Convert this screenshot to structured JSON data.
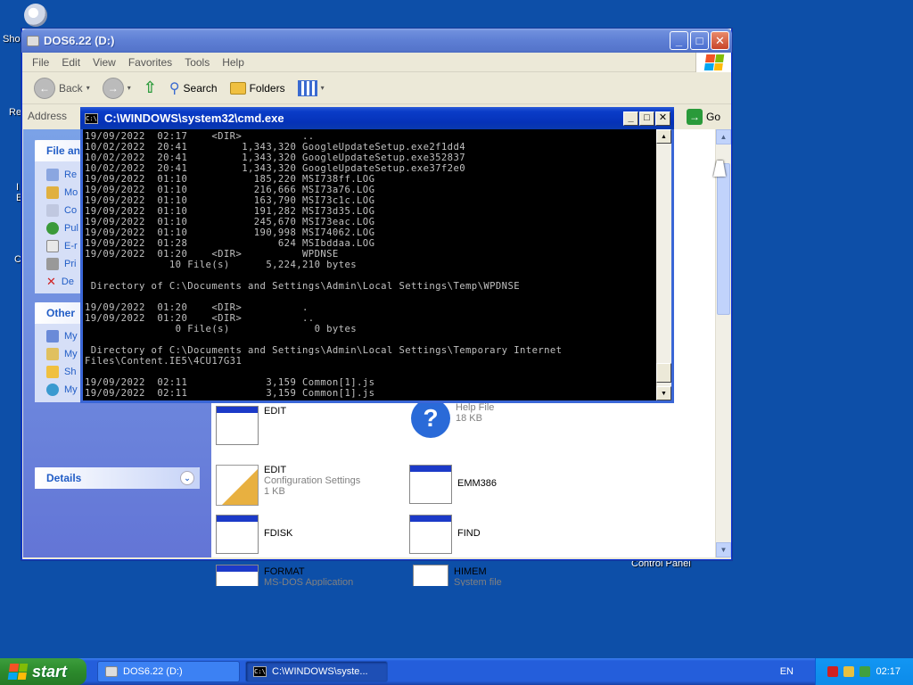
{
  "desktop": {
    "label_sho": "Sho",
    "label_re": "Re",
    "label_i": "I",
    "label_e": "E",
    "label_c": "C",
    "label_control_panel": "Control Panel"
  },
  "explorer": {
    "title": "DOS6.22 (D:)",
    "menu": [
      "File",
      "Edit",
      "View",
      "Favorites",
      "Tools",
      "Help"
    ],
    "toolbar": {
      "back": "Back",
      "search": "Search",
      "folders": "Folders"
    },
    "address_label": "Address",
    "go_label": "Go",
    "left": {
      "file_tasks_title": "File an",
      "file_tasks": [
        "Re",
        "Mo",
        "Co",
        "Pul",
        "E-r",
        "Pri",
        "De"
      ],
      "other_title": "Other",
      "other_items": [
        "My",
        "My",
        "Sh",
        "My Network Places"
      ],
      "details_title": "Details"
    },
    "files": [
      {
        "name": "EDIT",
        "sub1": "",
        "sub2": ""
      },
      {
        "name": "",
        "sub1": "Help File",
        "sub2": "18 KB"
      },
      {
        "name": "EDIT",
        "sub1": "Configuration Settings",
        "sub2": "1 KB"
      },
      {
        "name": "EMM386",
        "sub1": "",
        "sub2": ""
      },
      {
        "name": "FDISK",
        "sub1": "",
        "sub2": ""
      },
      {
        "name": "FIND",
        "sub1": "",
        "sub2": ""
      },
      {
        "name": "FORMAT",
        "sub1": "MS-DOS Application",
        "sub2": ""
      },
      {
        "name": "HIMEM",
        "sub1": "System file",
        "sub2": ""
      }
    ]
  },
  "cmd": {
    "title": "C:\\WINDOWS\\system32\\cmd.exe",
    "output": "19/09/2022  02:17    <DIR>          ..\n10/02/2022  20:41         1,343,320 GoogleUpdateSetup.exe2f1dd4\n10/02/2022  20:41         1,343,320 GoogleUpdateSetup.exe352837\n10/02/2022  20:41         1,343,320 GoogleUpdateSetup.exe37f2e0\n19/09/2022  01:10           185,220 MSI738ff.LOG\n19/09/2022  01:10           216,666 MSI73a76.LOG\n19/09/2022  01:10           163,790 MSI73c1c.LOG\n19/09/2022  01:10           191,282 MSI73d35.LOG\n19/09/2022  01:10           245,670 MSI73eac.LOG\n19/09/2022  01:10           190,998 MSI74062.LOG\n19/09/2022  01:28               624 MSIbddaa.LOG\n19/09/2022  01:20    <DIR>          WPDNSE\n              10 File(s)      5,224,210 bytes\n\n Directory of C:\\Documents and Settings\\Admin\\Local Settings\\Temp\\WPDNSE\n\n19/09/2022  01:20    <DIR>          .\n19/09/2022  01:20    <DIR>          ..\n               0 File(s)              0 bytes\n\n Directory of C:\\Documents and Settings\\Admin\\Local Settings\\Temporary Internet\nFiles\\Content.IE5\\4CU17G31\n\n19/09/2022  02:11             3,159 Common[1].js\n19/09/2022  02:11             3,159 Common[1].js"
  },
  "taskbar": {
    "start": "start",
    "tasks": [
      "DOS6.22 (D:)",
      "C:\\WINDOWS\\syste..."
    ],
    "lang": "EN",
    "clock": "02:17"
  }
}
